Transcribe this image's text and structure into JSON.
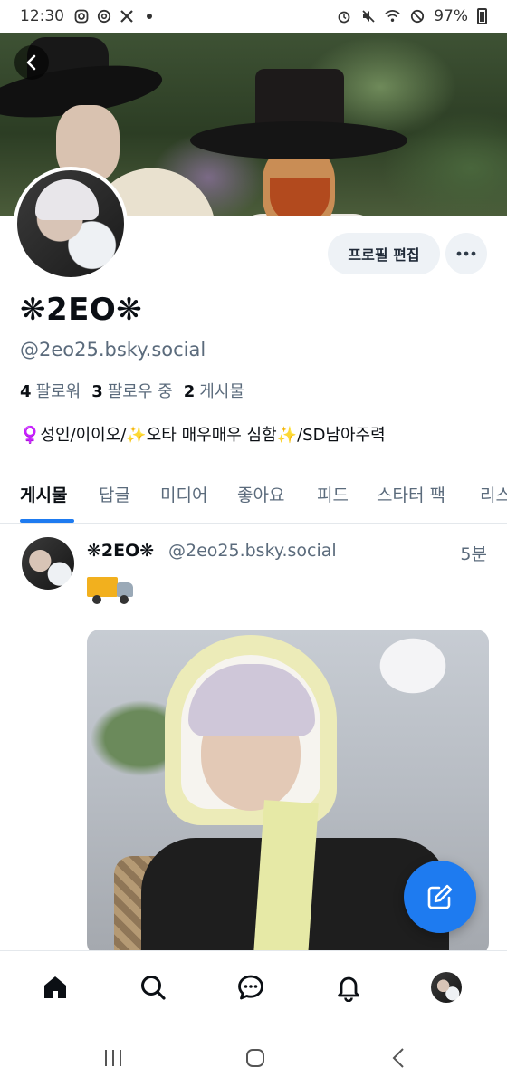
{
  "status_bar": {
    "time": "12:30",
    "battery": "97%",
    "left_icons": [
      "instagram-icon",
      "threads-icon",
      "x-icon",
      "dot-icon"
    ],
    "right_icons": [
      "alarm-icon",
      "mute-icon",
      "wifi-icon",
      "dnd-icon",
      "battery-icon"
    ]
  },
  "profile": {
    "display_name": "❋2EO❋",
    "handle": "@2eo25.bsky.social",
    "edit_button": "프로필 편집",
    "stats": {
      "followers_count": "4",
      "followers_label": "팔로워",
      "following_count": "3",
      "following_label": "팔로우 중",
      "posts_count": "2",
      "posts_label": "게시물"
    },
    "bio": "♀️성인/이이오/✨오타 매우매우 심함✨/SD남아주력"
  },
  "tabs": [
    {
      "label": "게시물",
      "active": true
    },
    {
      "label": "답글",
      "active": false
    },
    {
      "label": "미디어",
      "active": false
    },
    {
      "label": "좋아요",
      "active": false
    },
    {
      "label": "피드",
      "active": false
    },
    {
      "label": "스타터 팩",
      "active": false
    },
    {
      "label": "리스트",
      "active": false
    }
  ],
  "post": {
    "author": "❋2EO❋",
    "handle": "@2eo25.bsky.social",
    "time": "5분",
    "text_icon": "delivery-truck-emoji"
  },
  "bottom_nav": [
    "home-icon",
    "search-icon",
    "chat-icon",
    "bell-icon",
    "profile-avatar"
  ],
  "system_nav": [
    "recents-icon",
    "home-circle-icon",
    "back-chevron-icon"
  ],
  "colors": {
    "accent": "#1e7bf0",
    "text_primary": "#0b0f14",
    "text_secondary": "#5b6b7c",
    "button_bg": "#eef2f6"
  }
}
